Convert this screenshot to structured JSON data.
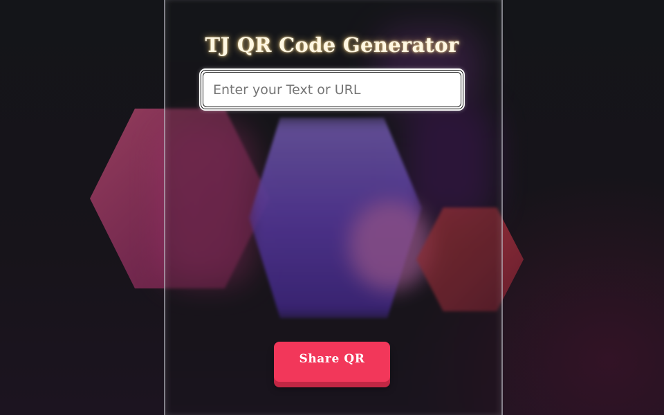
{
  "app": {
    "title": "TJ QR Code Generator"
  },
  "input": {
    "placeholder": "Enter your Text or URL",
    "value": ""
  },
  "actions": {
    "share_label": "Share QR"
  },
  "colors": {
    "accent": "#f2375a",
    "title_glow": "#ffd678",
    "hex_left": "#b8486f",
    "hex_right": "#c63a3f",
    "blob_purple": "#6a43c4"
  }
}
